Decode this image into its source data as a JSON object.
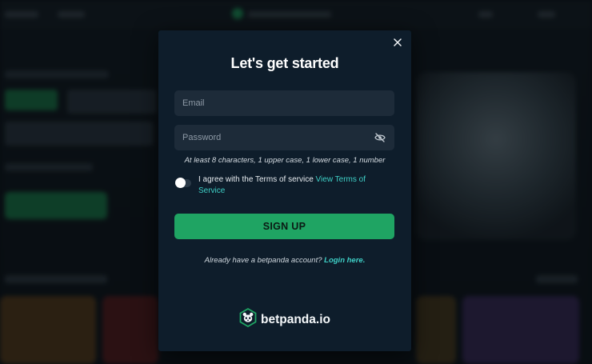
{
  "modal": {
    "title": "Let's get started",
    "close_icon": "close-icon",
    "email": {
      "placeholder": "Email",
      "value": ""
    },
    "password": {
      "placeholder": "Password",
      "value": "",
      "toggle_icon": "eye-off-icon"
    },
    "password_hint": "At least 8 characters, 1 upper case, 1 lower case, 1 number",
    "terms": {
      "toggle_on": false,
      "text": "I agree with the Terms of service ",
      "link_text": "View Terms of Service"
    },
    "signup_label": "SIGN UP",
    "login_prompt": {
      "text": "Already have a betpanda account? ",
      "link_text": "Login here."
    },
    "brand": {
      "icon": "panda-logo-icon",
      "name": "betpanda.io"
    },
    "colors": {
      "background": "#0e1d2b",
      "field": "#1d2b39",
      "primary": "#1fa463",
      "link": "#3fd0c7"
    }
  }
}
